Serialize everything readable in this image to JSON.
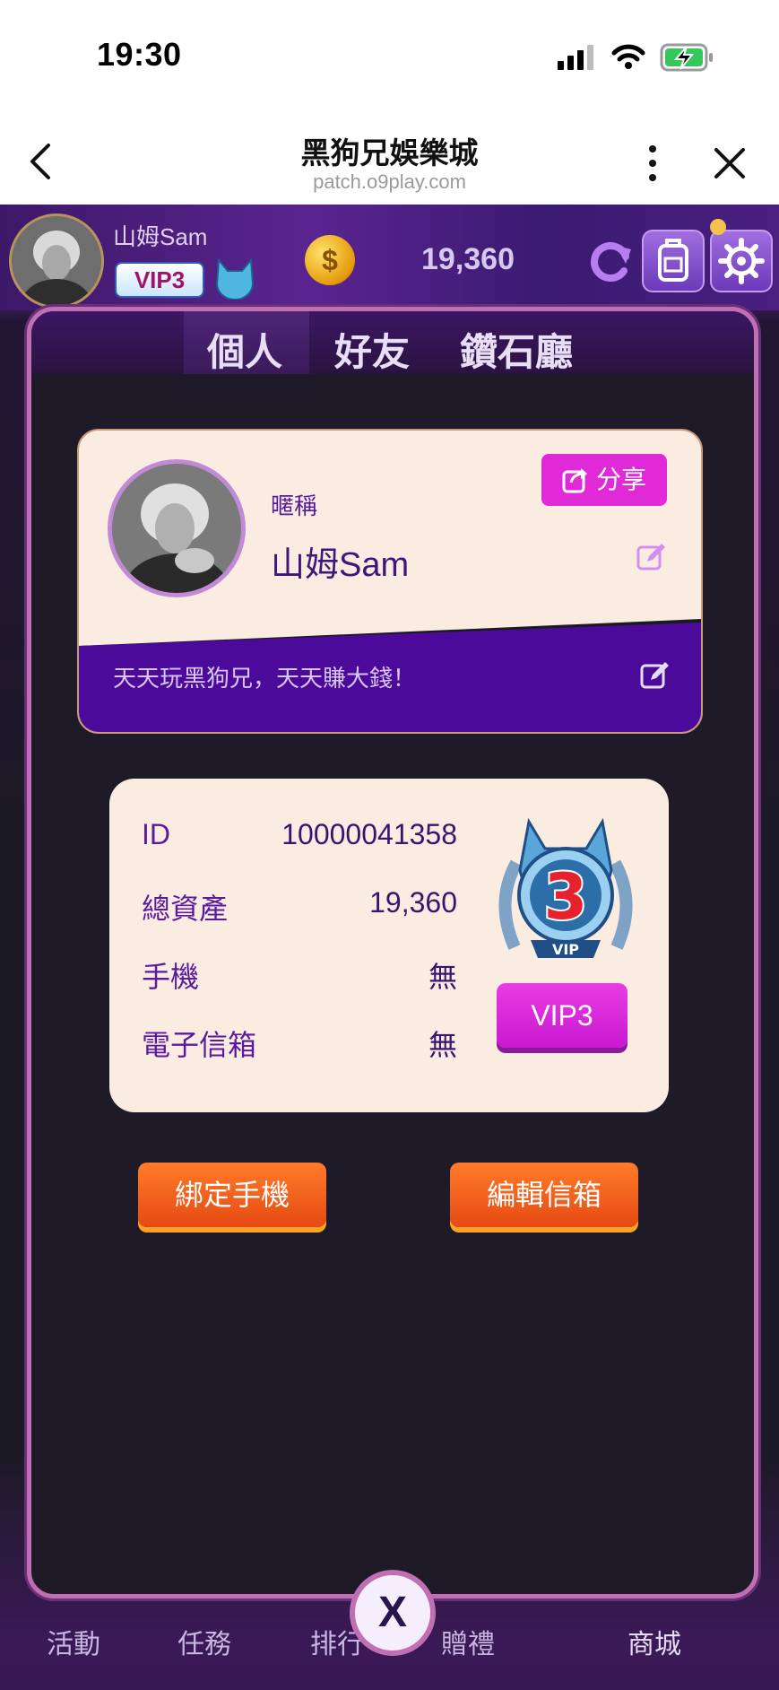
{
  "status_bar": {
    "time": "19:30"
  },
  "browser": {
    "title": "黑狗兄娛樂城",
    "url": "patch.o9play.com"
  },
  "header": {
    "player_name": "山姆Sam",
    "vip_badge": "VIP3",
    "balance": "19,360"
  },
  "tabs": [
    {
      "label": "個人",
      "active": true
    },
    {
      "label": "好友",
      "active": false
    },
    {
      "label": "鑽石廳",
      "active": false
    }
  ],
  "profile": {
    "nickname_label": "暱稱",
    "nickname": "山姆Sam",
    "share_label": "分享",
    "signature": "天天玩黑狗兄，天天賺大錢！"
  },
  "info": {
    "rows": [
      {
        "label": "ID",
        "value": "10000041358"
      },
      {
        "label": "總資產",
        "value": "19,360"
      },
      {
        "label": "手機",
        "value": "無"
      },
      {
        "label": "電子信箱",
        "value": "無"
      }
    ],
    "vip_medal_number": "3",
    "vip_medal_text": "VIP",
    "vip_button": "VIP3"
  },
  "actions": {
    "bind_phone": "綁定手機",
    "edit_email": "編輯信箱"
  },
  "bottom_nav": [
    {
      "label": "活動"
    },
    {
      "label": "任務"
    },
    {
      "label": "排行"
    },
    {
      "label": "贈禮"
    },
    {
      "label": "商城"
    }
  ],
  "close_symbol": "X",
  "colors": {
    "accent_purple": "#4b0a9a",
    "accent_magenta": "#e02ad8",
    "accent_orange": "#ff7b2a",
    "card_bg": "#fbece1"
  }
}
